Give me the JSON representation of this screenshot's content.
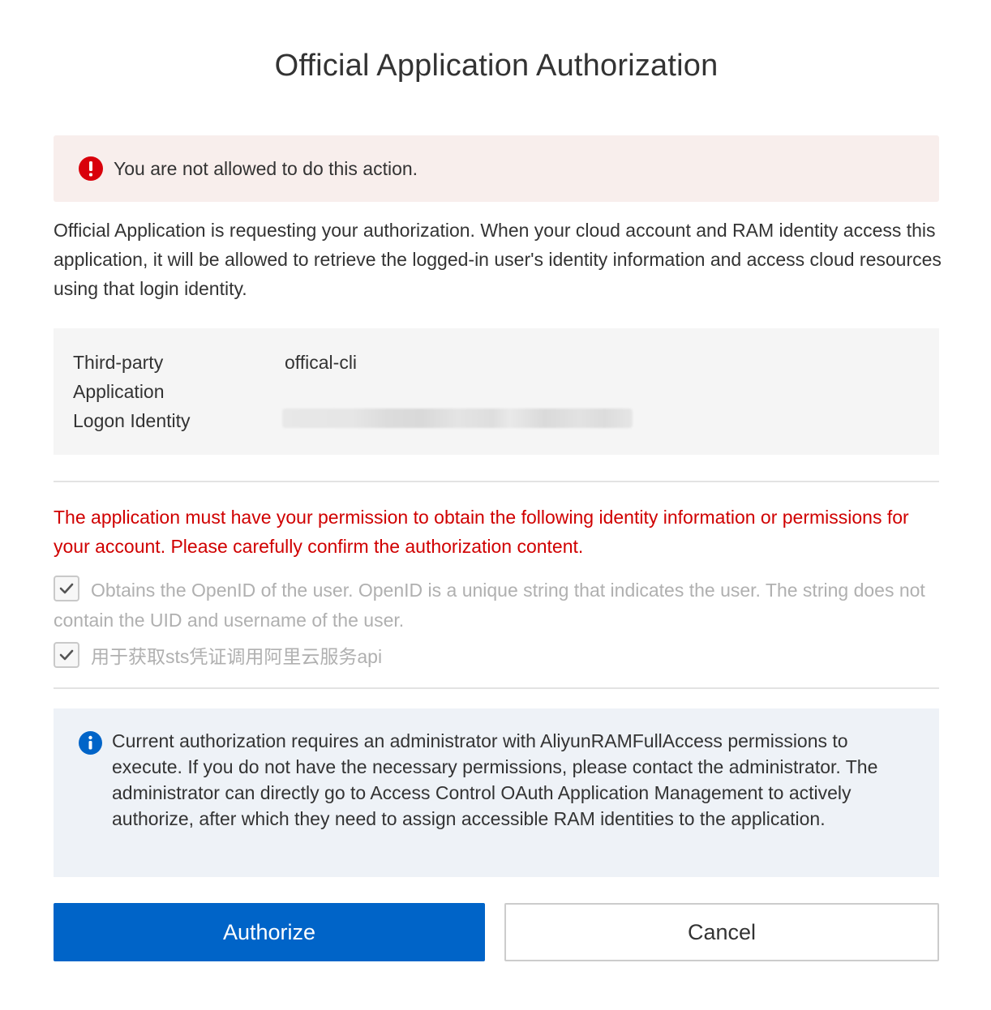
{
  "title": "Official Application Authorization",
  "error_alert": {
    "icon": "error-exclamation-icon",
    "message": "You are not allowed to do this action.",
    "icon_color": "#d9000b",
    "background": "#f8eeec"
  },
  "description": "Official Application is requesting your authorization. When your cloud account and RAM identity access this application, it will be allowed to retrieve the logged-in user's identity information and access cloud resources using that login identity.",
  "app_info": {
    "app_label": "Third-party Application",
    "app_value": "offical-cli",
    "logon_label": "Logon Identity"
  },
  "permissions": {
    "warning": "The application must have your permission to obtain the following identity information or permissions for your account. Please carefully confirm the authorization content.",
    "warning_color": "#d00000",
    "items": [
      {
        "label": "Obtains the OpenID of the user. OpenID is a unique string that indicates the user. The string does not contain the UID and username of the user.",
        "checked": true
      },
      {
        "label": "用于获取sts凭证调用阿里云服务api",
        "checked": true
      }
    ]
  },
  "notice": {
    "icon": "info-icon",
    "text": "Current authorization requires an administrator with AliyunRAMFullAccess permissions to execute. If you do not have the necessary permissions, please contact the administrator. The administrator can directly go to Access Control OAuth Application Management to actively authorize, after which they need to assign accessible RAM identities to the application."
  },
  "buttons": {
    "authorize": "Authorize",
    "cancel": "Cancel",
    "primary_color": "#0064c8"
  }
}
